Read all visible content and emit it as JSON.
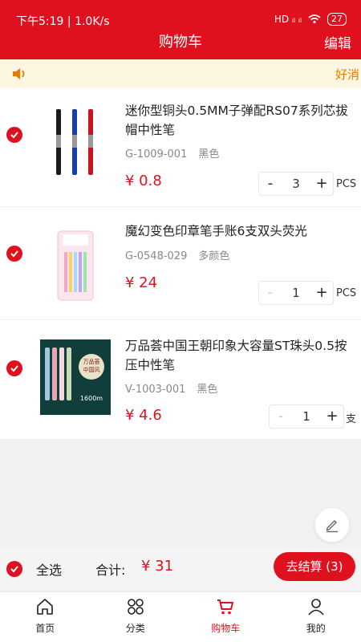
{
  "status": {
    "time": "下午5:19",
    "speed": "| 1.0K/s",
    "signals": "HD ᵢₗ ᵢₗ",
    "battery": "27"
  },
  "header": {
    "title": "购物车",
    "edit_label": "编辑"
  },
  "notice": {
    "text": "好消"
  },
  "cart": {
    "items": [
      {
        "name": "迷你型铜头0.5MM子弹配RS07系列芯拔帽中性笔",
        "sku": "G-1009-001",
        "color": "黑色",
        "price": "¥ 0.8",
        "qty": "3",
        "unit": "PCS"
      },
      {
        "name": "魔幻变色印章笔手账6支双头荧光",
        "sku": "G-0548-029",
        "color": "多颜色",
        "price": "¥ 24",
        "qty": "1",
        "unit": "PCS"
      },
      {
        "name": "万品荟中国王朝印象大容量ST珠头0.5按压中性笔",
        "sku": "V-1003-001",
        "color": "黑色",
        "price": "¥ 4.6",
        "qty": "1",
        "unit": "支"
      }
    ],
    "minus_label": "-",
    "plus_label": "+",
    "packaging_text": {
      "brand": "万品荟",
      "series": "中国风",
      "count": "1600m"
    }
  },
  "footer": {
    "select_all": "全选",
    "total_label": "合计:",
    "total_value": "¥ 31",
    "checkout_label": "去结算 (3)"
  },
  "tabs": [
    {
      "label": "首页",
      "icon": "home-icon"
    },
    {
      "label": "分类",
      "icon": "category-icon"
    },
    {
      "label": "购物车",
      "icon": "cart-icon"
    },
    {
      "label": "我的",
      "icon": "user-icon"
    }
  ],
  "colors": {
    "brand": "#e0111f",
    "notice_bg": "#fdf7e1",
    "notice_text": "#e87a00"
  }
}
